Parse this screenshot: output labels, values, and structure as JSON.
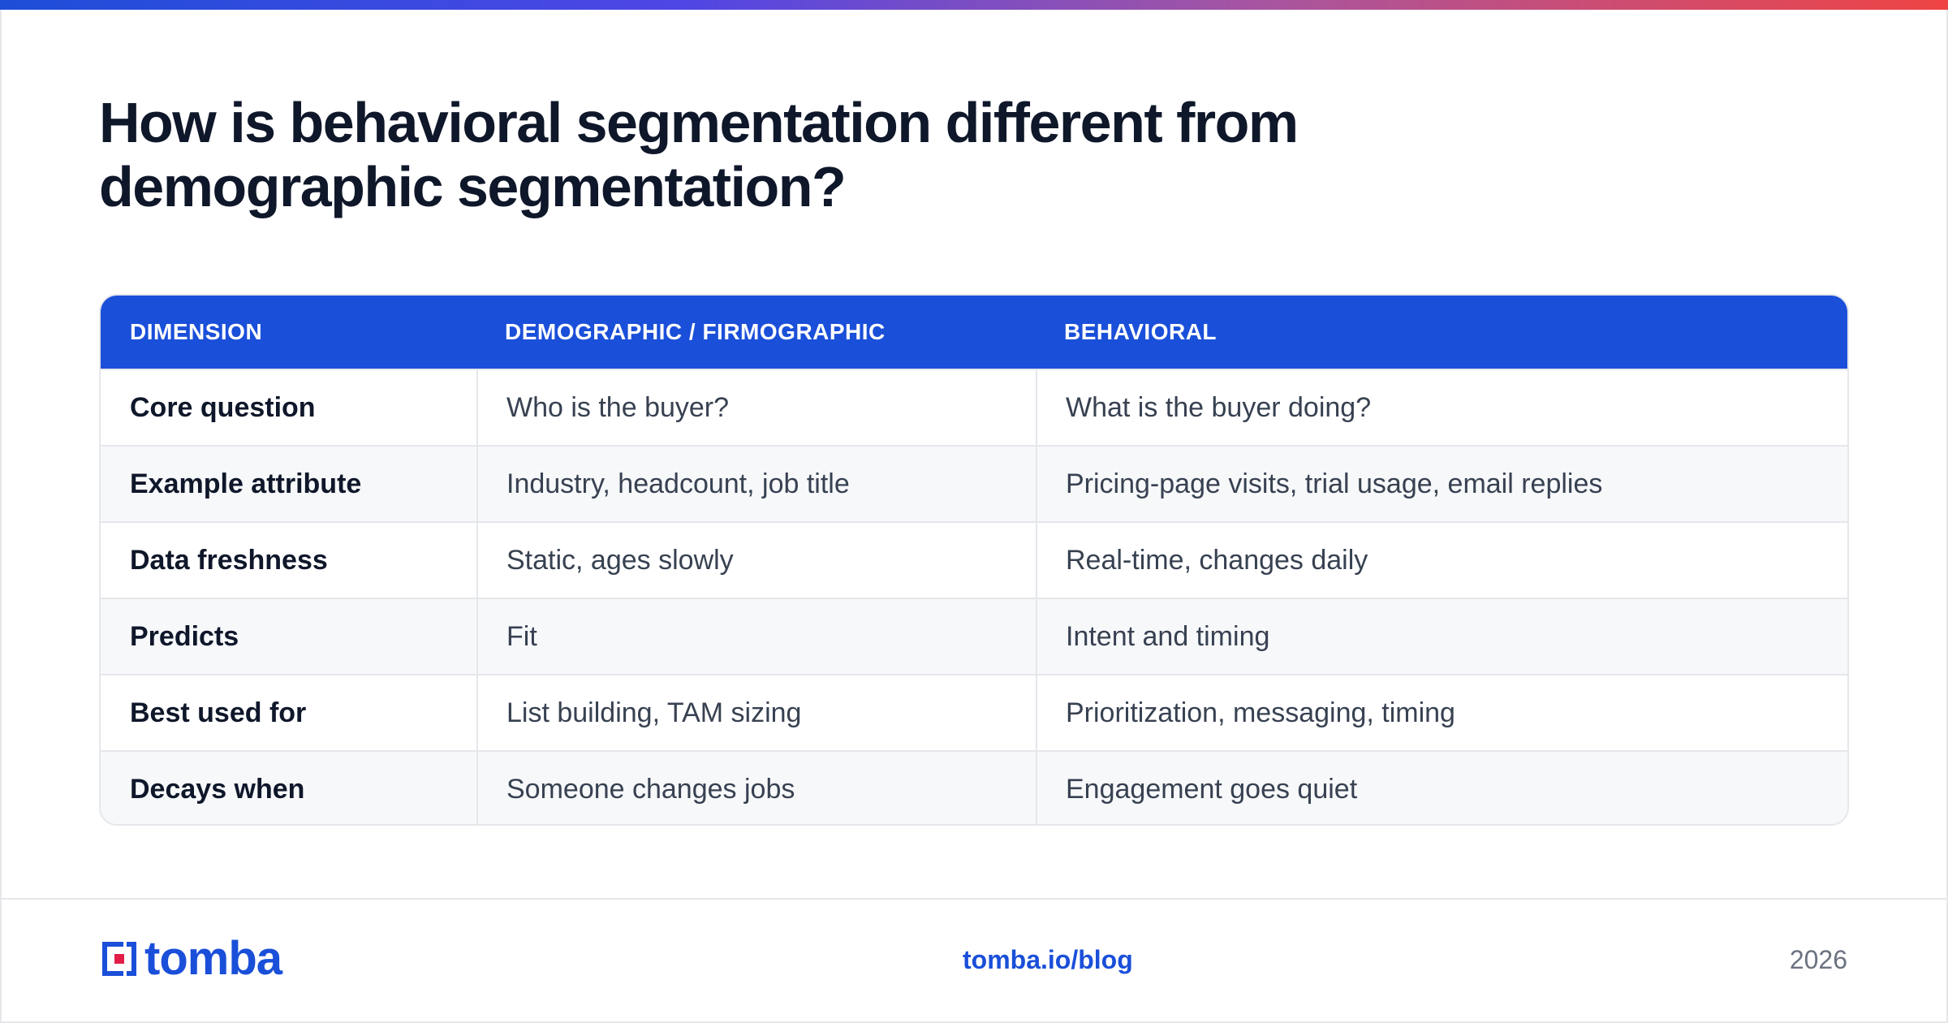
{
  "title": "How is behavioral segmentation different from demographic segmentation?",
  "table": {
    "headers": [
      "DIMENSION",
      "DEMOGRAPHIC / FIRMOGRAPHIC",
      "BEHAVIORAL"
    ],
    "rows": [
      [
        "Core question",
        "Who is the buyer?",
        "What is the buyer doing?"
      ],
      [
        "Example attribute",
        "Industry, headcount, job title",
        "Pricing-page visits, trial usage, email replies"
      ],
      [
        "Data freshness",
        "Static, ages slowly",
        "Real-time, changes daily"
      ],
      [
        "Predicts",
        "Fit",
        "Intent and timing"
      ],
      [
        "Best used for",
        "List building, TAM sizing",
        "Prioritization, messaging, timing"
      ],
      [
        "Decays when",
        "Someone changes jobs",
        "Engagement goes quiet"
      ]
    ]
  },
  "footer": {
    "logo_text": "tomba",
    "url": "tomba.io/blog",
    "year": "2026"
  },
  "colors": {
    "accent": "#1a4fd9",
    "header_bg": "#1a4fd9",
    "row_alt_bg": "#f7f8fa"
  }
}
